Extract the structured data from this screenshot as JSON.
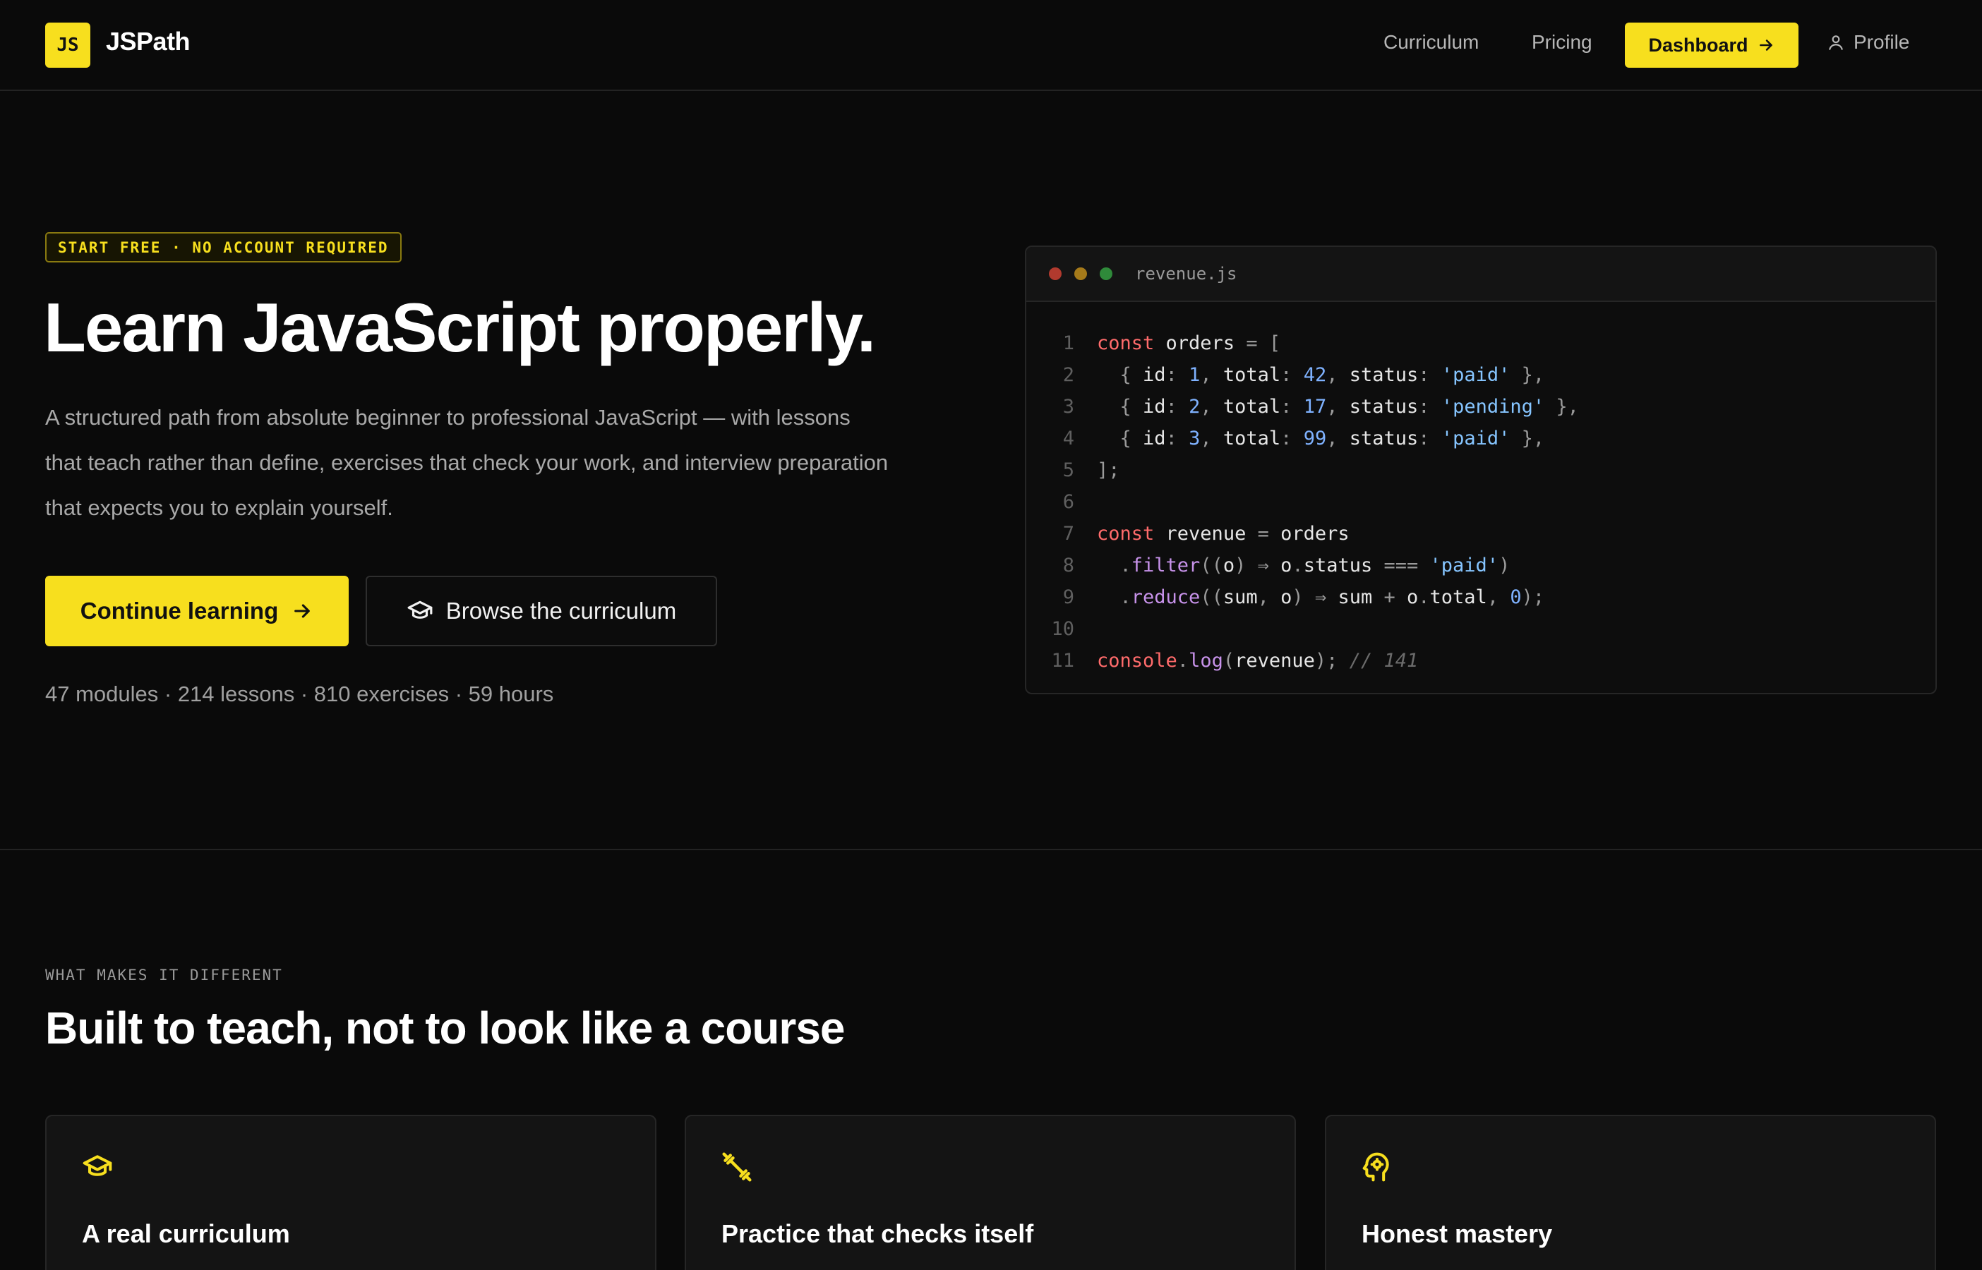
{
  "header": {
    "logo_badge": "JS",
    "brand": "JSPath",
    "nav": {
      "curriculum": "Curriculum",
      "pricing": "Pricing",
      "dashboard": "Dashboard",
      "profile": "Profile"
    }
  },
  "hero": {
    "badge": "START FREE · NO ACCOUNT REQUIRED",
    "title": "Learn JavaScript properly.",
    "description": "A structured path from absolute beginner to professional JavaScript — with lessons that teach rather than define, exercises that check your work, and interview preparation that expects you to explain yourself.",
    "primary_button": "Continue learning",
    "secondary_button": "Browse the curriculum",
    "stats": "47 modules · 214 lessons · 810 exercises · 59 hours"
  },
  "code_window": {
    "filename": "revenue.js",
    "line_numbers": [
      "1",
      "2",
      "3",
      "4",
      "5",
      "6",
      "7",
      "8",
      "9",
      "10",
      "11"
    ]
  },
  "features": {
    "label": "WHAT MAKES IT DIFFERENT",
    "title": "Built to teach, not to look like a course",
    "cards": [
      {
        "title": "A real curriculum",
        "icon": "graduation-cap-icon"
      },
      {
        "title": "Practice that checks itself",
        "icon": "dumbbell-icon"
      },
      {
        "title": "Honest mastery",
        "icon": "brain-head-icon"
      }
    ]
  },
  "colors": {
    "accent": "#f7df1e",
    "background": "#0a0a0a"
  }
}
